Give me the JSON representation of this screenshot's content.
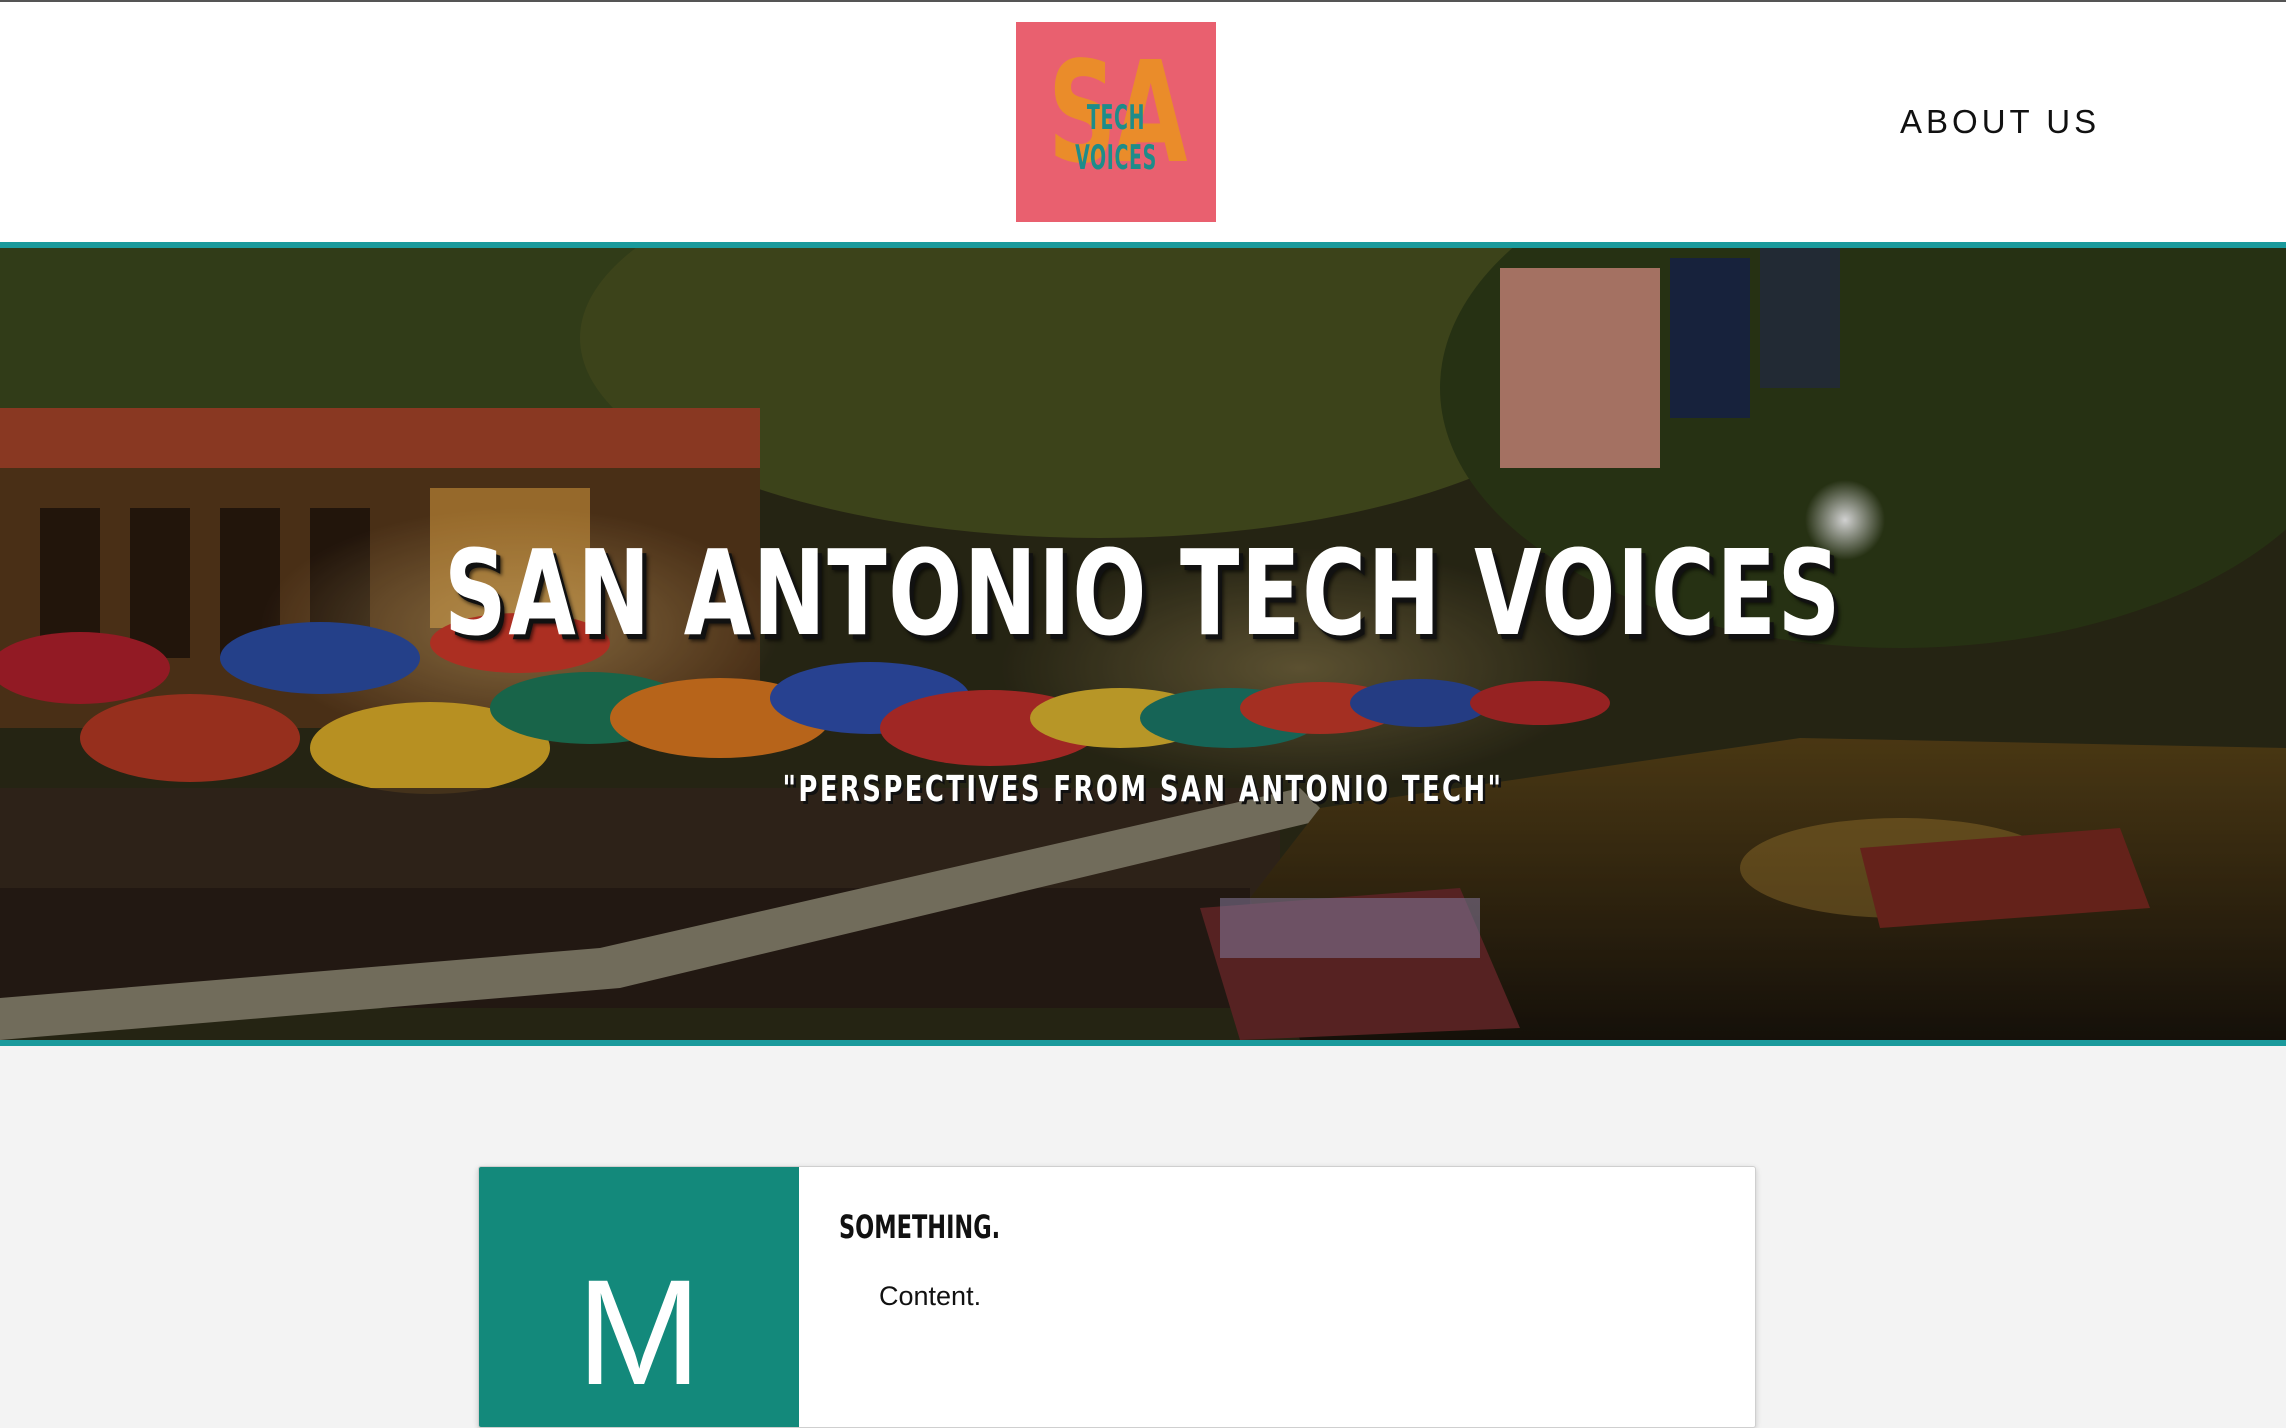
{
  "header": {
    "logo": {
      "initials": "SA",
      "wordmark": "TECH VOICES",
      "background_color": "#e9606f",
      "initials_color": "#ea8c2a",
      "wordmark_color": "#1e8c8a"
    },
    "nav": {
      "about_label": "ABOUT US"
    }
  },
  "hero": {
    "title": "SAN ANTONIO TECH VOICES",
    "subtitle": "\"PERSPECTIVES FROM SAN ANTONIO TECH\"",
    "border_color": "#1a9a9c",
    "background_image": "night-riverwalk-photo"
  },
  "posts": [
    {
      "thumb_letter": "M",
      "thumb_color": "#13897b",
      "title": "SOMETHING.",
      "body": "Content."
    }
  ]
}
